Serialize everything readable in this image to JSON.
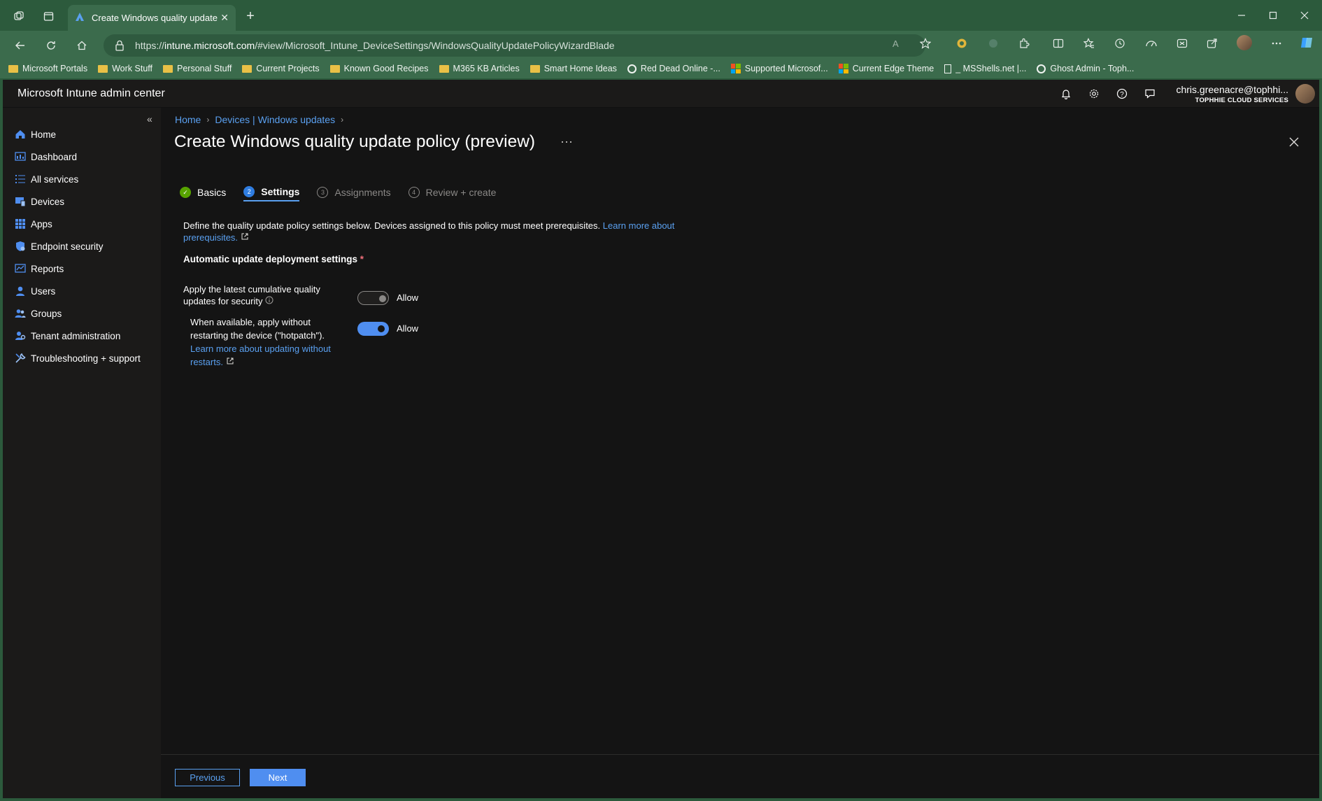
{
  "browser": {
    "tab_title": "Create Windows quality update p",
    "url_prefix": "https://",
    "url_host": "intune.microsoft.com",
    "url_path": "/#view/Microsoft_Intune_DeviceSettings/WindowsQualityUpdatePolicyWizardBlade",
    "favorites": [
      {
        "label": "Microsoft Portals",
        "icon": "folder"
      },
      {
        "label": "Work Stuff",
        "icon": "folder"
      },
      {
        "label": "Personal Stuff",
        "icon": "folder"
      },
      {
        "label": "Current Projects",
        "icon": "folder"
      },
      {
        "label": "Known Good Recipes",
        "icon": "folder"
      },
      {
        "label": "M365 KB Articles",
        "icon": "folder"
      },
      {
        "label": "Smart Home Ideas",
        "icon": "folder"
      },
      {
        "label": "Red Dead Online -...",
        "icon": "site"
      },
      {
        "label": "Supported Microsof...",
        "icon": "ms"
      },
      {
        "label": "Current Edge Theme",
        "icon": "ms"
      },
      {
        "label": "_ MSShells.net |...",
        "icon": "page"
      },
      {
        "label": "Ghost Admin - Toph...",
        "icon": "site"
      }
    ]
  },
  "portal": {
    "title": "Microsoft Intune admin center",
    "user_name": "chris.greenacre@tophhi...",
    "user_org": "TOPHHIE CLOUD SERVICES"
  },
  "sidebar": {
    "items": [
      {
        "label": "Home",
        "icon": "home-icon",
        "color": "#4f8ef0"
      },
      {
        "label": "Dashboard",
        "icon": "dashboard-icon",
        "color": "#4f8ef0"
      },
      {
        "label": "All services",
        "icon": "list-icon",
        "color": "#4f8ef0"
      },
      {
        "label": "Devices",
        "icon": "devices-icon",
        "color": "#4f8ef0"
      },
      {
        "label": "Apps",
        "icon": "apps-icon",
        "color": "#4f8ef0"
      },
      {
        "label": "Endpoint security",
        "icon": "shield-icon",
        "color": "#4f8ef0"
      },
      {
        "label": "Reports",
        "icon": "reports-icon",
        "color": "#4f8ef0"
      },
      {
        "label": "Users",
        "icon": "user-icon",
        "color": "#4f8ef0"
      },
      {
        "label": "Groups",
        "icon": "groups-icon",
        "color": "#4f8ef0"
      },
      {
        "label": "Tenant administration",
        "icon": "tenant-icon",
        "color": "#4f8ef0"
      },
      {
        "label": "Troubleshooting + support",
        "icon": "wrench-icon",
        "color": "#4f8ef0"
      }
    ]
  },
  "breadcrumb": [
    "Home",
    "Devices | Windows updates"
  ],
  "page_title": "Create Windows quality update policy (preview)",
  "more_label": "···",
  "steps": [
    {
      "label": "Basics",
      "num": "✓",
      "state": "done"
    },
    {
      "label": "Settings",
      "num": "2",
      "state": "active"
    },
    {
      "label": "Assignments",
      "num": "3",
      "state": "todo"
    },
    {
      "label": "Review + create",
      "num": "4",
      "state": "todo"
    }
  ],
  "description": {
    "text": "Define the quality update policy settings below. Devices assigned to this policy must meet prerequisites.",
    "link_part1": "Learn more about",
    "link_part2": "prerequisites."
  },
  "section_title": "Automatic update deployment settings",
  "settings": [
    {
      "label_line1": "Apply the latest cumulative quality",
      "label_line2": "updates for security",
      "toggle": "off",
      "toggle_label": "Allow"
    },
    {
      "label_line1": "When available, apply without",
      "label_line2": "restarting the device (\"hotpatch\").",
      "link_line1": "Learn more about updating without",
      "link_line2": "restarts.",
      "toggle": "on",
      "toggle_label": "Allow"
    }
  ],
  "footer": {
    "previous_label": "Previous",
    "next_label": "Next"
  }
}
